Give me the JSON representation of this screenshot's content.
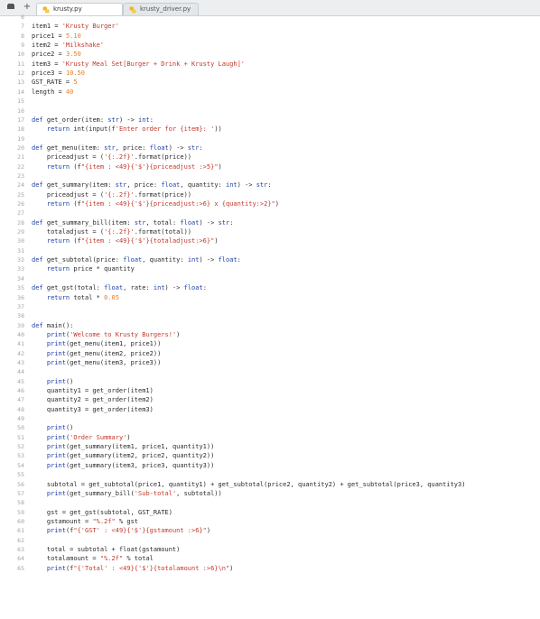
{
  "toolbar": {
    "menu_icon": "menu-icon",
    "new_tab_icon": "plus-icon",
    "new_tab_label": "+"
  },
  "tabs": [
    {
      "label": "krusty.py",
      "active": true,
      "icon": "python-icon"
    },
    {
      "label": "krusty_driver.py",
      "active": false,
      "icon": "python-icon"
    }
  ],
  "colors": {
    "keyword": "#1f3fa8",
    "string": "#c0392b",
    "number": "#e67e22",
    "line_number": "#a0a4a8",
    "text": "#2b2b2b"
  },
  "lines": [
    {
      "n": "6",
      "tokens": []
    },
    {
      "n": "7",
      "tokens": [
        {
          "t": "item1 = "
        },
        {
          "t": "'Krusty Burger'",
          "c": "st"
        }
      ]
    },
    {
      "n": "8",
      "tokens": [
        {
          "t": "price1 = "
        },
        {
          "t": "5.10",
          "c": "nm"
        }
      ]
    },
    {
      "n": "9",
      "tokens": [
        {
          "t": "item2 = "
        },
        {
          "t": "'Milkshake'",
          "c": "st"
        }
      ]
    },
    {
      "n": "10",
      "tokens": [
        {
          "t": "price2 = "
        },
        {
          "t": "3.50",
          "c": "nm"
        }
      ]
    },
    {
      "n": "11",
      "tokens": [
        {
          "t": "item3 = "
        },
        {
          "t": "'Krusty Meal Set[Burger + Drink + Krusty Laugh]'",
          "c": "st"
        }
      ]
    },
    {
      "n": "12",
      "tokens": [
        {
          "t": "price3 = "
        },
        {
          "t": "10.50",
          "c": "nm"
        }
      ]
    },
    {
      "n": "13",
      "tokens": [
        {
          "t": "GST_RATE = "
        },
        {
          "t": "5",
          "c": "nm"
        }
      ]
    },
    {
      "n": "14",
      "tokens": [
        {
          "t": "length = "
        },
        {
          "t": "40",
          "c": "nm"
        }
      ]
    },
    {
      "n": "15",
      "tokens": []
    },
    {
      "n": "16",
      "tokens": []
    },
    {
      "n": "17",
      "tokens": [
        {
          "t": "def",
          "c": "kw"
        },
        {
          "t": " get_order(item: "
        },
        {
          "t": "str",
          "c": "kw"
        },
        {
          "t": ") -> "
        },
        {
          "t": "int",
          "c": "kw"
        },
        {
          "t": ":"
        }
      ]
    },
    {
      "n": "18",
      "tokens": [
        {
          "t": "    "
        },
        {
          "t": "return",
          "c": "kw"
        },
        {
          "t": " int(input(f"
        },
        {
          "t": "'Enter order for {item}: '",
          "c": "st"
        },
        {
          "t": "))"
        }
      ]
    },
    {
      "n": "19",
      "tokens": []
    },
    {
      "n": "20",
      "tokens": [
        {
          "t": "def",
          "c": "kw"
        },
        {
          "t": " get_menu(item: "
        },
        {
          "t": "str",
          "c": "kw"
        },
        {
          "t": ", price: "
        },
        {
          "t": "float",
          "c": "kw"
        },
        {
          "t": ") -> "
        },
        {
          "t": "str",
          "c": "kw"
        },
        {
          "t": ":"
        }
      ]
    },
    {
      "n": "21",
      "tokens": [
        {
          "t": "    priceadjust = ("
        },
        {
          "t": "'{:.2f}'",
          "c": "st"
        },
        {
          "t": ".format(price))"
        }
      ]
    },
    {
      "n": "22",
      "tokens": [
        {
          "t": "    "
        },
        {
          "t": "return",
          "c": "kw"
        },
        {
          "t": " (f"
        },
        {
          "t": "\"{item : <49}{'$'}{priceadjust :>5}\"",
          "c": "st"
        },
        {
          "t": ")"
        }
      ]
    },
    {
      "n": "23",
      "tokens": []
    },
    {
      "n": "24",
      "tokens": [
        {
          "t": "def",
          "c": "kw"
        },
        {
          "t": " get_summary(item: "
        },
        {
          "t": "str",
          "c": "kw"
        },
        {
          "t": ", price: "
        },
        {
          "t": "float",
          "c": "kw"
        },
        {
          "t": ", quantity: "
        },
        {
          "t": "int",
          "c": "kw"
        },
        {
          "t": ") -> "
        },
        {
          "t": "str",
          "c": "kw"
        },
        {
          "t": ":"
        }
      ]
    },
    {
      "n": "25",
      "tokens": [
        {
          "t": "    priceadjust = ("
        },
        {
          "t": "'{:.2f}'",
          "c": "st"
        },
        {
          "t": ".format(price))"
        }
      ]
    },
    {
      "n": "26",
      "tokens": [
        {
          "t": "    "
        },
        {
          "t": "return",
          "c": "kw"
        },
        {
          "t": " (f"
        },
        {
          "t": "\"{item : <49}{'$'}{priceadjust:>6} x {quantity:>2}\"",
          "c": "st"
        },
        {
          "t": ")"
        }
      ]
    },
    {
      "n": "27",
      "tokens": []
    },
    {
      "n": "28",
      "tokens": [
        {
          "t": "def",
          "c": "kw"
        },
        {
          "t": " get_summary_bill(item: "
        },
        {
          "t": "str",
          "c": "kw"
        },
        {
          "t": ", total: "
        },
        {
          "t": "float",
          "c": "kw"
        },
        {
          "t": ") -> "
        },
        {
          "t": "str",
          "c": "kw"
        },
        {
          "t": ":"
        }
      ]
    },
    {
      "n": "29",
      "tokens": [
        {
          "t": "    totaladjust = ("
        },
        {
          "t": "'{:.2f}'",
          "c": "st"
        },
        {
          "t": ".format(total))"
        }
      ]
    },
    {
      "n": "30",
      "tokens": [
        {
          "t": "    "
        },
        {
          "t": "return",
          "c": "kw"
        },
        {
          "t": " (f"
        },
        {
          "t": "\"{item : <49}{'$'}{totaladjust:>6}\"",
          "c": "st"
        },
        {
          "t": ")"
        }
      ]
    },
    {
      "n": "31",
      "tokens": []
    },
    {
      "n": "32",
      "tokens": [
        {
          "t": "def",
          "c": "kw"
        },
        {
          "t": " get_subtotal(price: "
        },
        {
          "t": "float",
          "c": "kw"
        },
        {
          "t": ", quantity: "
        },
        {
          "t": "int",
          "c": "kw"
        },
        {
          "t": ") -> "
        },
        {
          "t": "float",
          "c": "kw"
        },
        {
          "t": ":"
        }
      ]
    },
    {
      "n": "33",
      "tokens": [
        {
          "t": "    "
        },
        {
          "t": "return",
          "c": "kw"
        },
        {
          "t": " price * quantity"
        }
      ]
    },
    {
      "n": "34",
      "tokens": []
    },
    {
      "n": "35",
      "tokens": [
        {
          "t": "def",
          "c": "kw"
        },
        {
          "t": " get_gst(total: "
        },
        {
          "t": "float",
          "c": "kw"
        },
        {
          "t": ", rate: "
        },
        {
          "t": "int",
          "c": "kw"
        },
        {
          "t": ") -> "
        },
        {
          "t": "float",
          "c": "kw"
        },
        {
          "t": ":"
        }
      ]
    },
    {
      "n": "36",
      "tokens": [
        {
          "t": "    "
        },
        {
          "t": "return",
          "c": "kw"
        },
        {
          "t": " total * "
        },
        {
          "t": "0.05",
          "c": "nm"
        }
      ]
    },
    {
      "n": "37",
      "tokens": []
    },
    {
      "n": "38",
      "tokens": []
    },
    {
      "n": "39",
      "tokens": [
        {
          "t": "def",
          "c": "kw"
        },
        {
          "t": " main():"
        }
      ]
    },
    {
      "n": "40",
      "tokens": [
        {
          "t": "    "
        },
        {
          "t": "print",
          "c": "kw"
        },
        {
          "t": "("
        },
        {
          "t": "'Welcome to Krusty Burgers!'",
          "c": "st"
        },
        {
          "t": ")"
        }
      ]
    },
    {
      "n": "41",
      "tokens": [
        {
          "t": "    "
        },
        {
          "t": "print",
          "c": "kw"
        },
        {
          "t": "(get_menu(item1, price1))"
        }
      ]
    },
    {
      "n": "42",
      "tokens": [
        {
          "t": "    "
        },
        {
          "t": "print",
          "c": "kw"
        },
        {
          "t": "(get_menu(item2, price2))"
        }
      ]
    },
    {
      "n": "43",
      "tokens": [
        {
          "t": "    "
        },
        {
          "t": "print",
          "c": "kw"
        },
        {
          "t": "(get_menu(item3, price3))"
        }
      ]
    },
    {
      "n": "44",
      "tokens": []
    },
    {
      "n": "45",
      "tokens": [
        {
          "t": "    "
        },
        {
          "t": "print",
          "c": "kw"
        },
        {
          "t": "()"
        }
      ]
    },
    {
      "n": "46",
      "tokens": [
        {
          "t": "    quantity1 = get_order(item1)"
        }
      ]
    },
    {
      "n": "47",
      "tokens": [
        {
          "t": "    quantity2 = get_order(item2)"
        }
      ]
    },
    {
      "n": "48",
      "tokens": [
        {
          "t": "    quantity3 = get_order(item3)"
        }
      ]
    },
    {
      "n": "49",
      "tokens": []
    },
    {
      "n": "50",
      "tokens": [
        {
          "t": "    "
        },
        {
          "t": "print",
          "c": "kw"
        },
        {
          "t": "()"
        }
      ]
    },
    {
      "n": "51",
      "tokens": [
        {
          "t": "    "
        },
        {
          "t": "print",
          "c": "kw"
        },
        {
          "t": "("
        },
        {
          "t": "'Order Summary'",
          "c": "st"
        },
        {
          "t": ")"
        }
      ]
    },
    {
      "n": "52",
      "tokens": [
        {
          "t": "    "
        },
        {
          "t": "print",
          "c": "kw"
        },
        {
          "t": "(get_summary(item1, price1, quantity1))"
        }
      ]
    },
    {
      "n": "53",
      "tokens": [
        {
          "t": "    "
        },
        {
          "t": "print",
          "c": "kw"
        },
        {
          "t": "(get_summary(item2, price2, quantity2))"
        }
      ]
    },
    {
      "n": "54",
      "tokens": [
        {
          "t": "    "
        },
        {
          "t": "print",
          "c": "kw"
        },
        {
          "t": "(get_summary(item3, price3, quantity3))"
        }
      ]
    },
    {
      "n": "55",
      "tokens": []
    },
    {
      "n": "56",
      "tokens": [
        {
          "t": "    subtotal = get_subtotal(price1, quantity1) + get_subtotal(price2, quantity2) + get_subtotal(price3, quantity3)"
        }
      ]
    },
    {
      "n": "57",
      "tokens": [
        {
          "t": "    "
        },
        {
          "t": "print",
          "c": "kw"
        },
        {
          "t": "(get_summary_bill("
        },
        {
          "t": "'Sub-total'",
          "c": "st"
        },
        {
          "t": ", subtotal))"
        }
      ]
    },
    {
      "n": "58",
      "tokens": []
    },
    {
      "n": "59",
      "tokens": [
        {
          "t": "    gst = get_gst(subtotal, GST_RATE)"
        }
      ]
    },
    {
      "n": "60",
      "tokens": [
        {
          "t": "    gstamount = "
        },
        {
          "t": "\"%.2f\"",
          "c": "st"
        },
        {
          "t": " % gst"
        }
      ]
    },
    {
      "n": "61",
      "tokens": [
        {
          "t": "    "
        },
        {
          "t": "print",
          "c": "kw"
        },
        {
          "t": "(f"
        },
        {
          "t": "\"{'GST' : <49}{'$'}{gstamount :>6}\"",
          "c": "st"
        },
        {
          "t": ")"
        }
      ]
    },
    {
      "n": "62",
      "tokens": []
    },
    {
      "n": "63",
      "tokens": [
        {
          "t": "    total = subtotal + float(gstamount)"
        }
      ]
    },
    {
      "n": "64",
      "tokens": [
        {
          "t": "    totalamount = "
        },
        {
          "t": "\"%.2f\"",
          "c": "st"
        },
        {
          "t": " % total"
        }
      ]
    },
    {
      "n": "65",
      "tokens": [
        {
          "t": "    "
        },
        {
          "t": "print",
          "c": "kw"
        },
        {
          "t": "(f"
        },
        {
          "t": "\"{'Total' : <49}{'$'}{totalamount :>6}\\n\"",
          "c": "st"
        },
        {
          "t": ")"
        }
      ]
    }
  ]
}
